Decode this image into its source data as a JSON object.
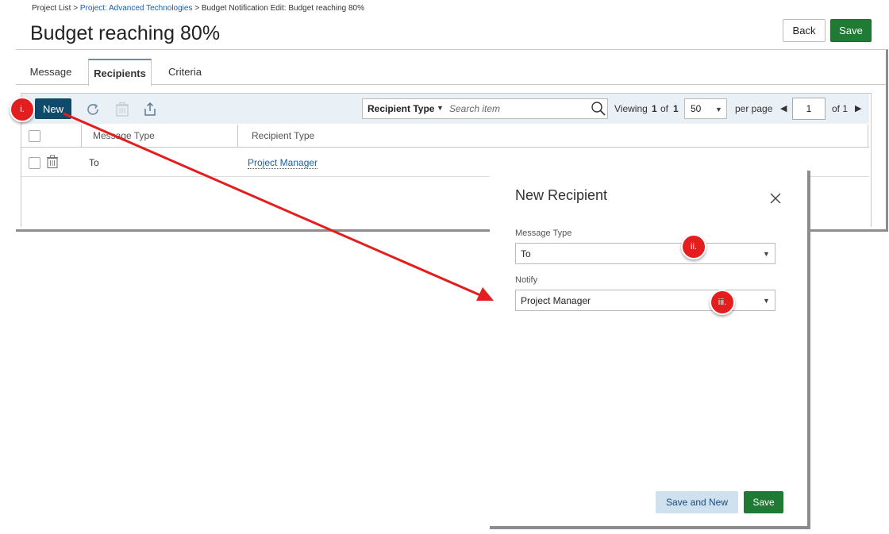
{
  "breadcrumb": {
    "item1": "Project List",
    "sep1": ">",
    "item2": "Project: Advanced Technologies",
    "sep2": ">",
    "item3": "Budget Notification Edit: Budget reaching 80%"
  },
  "header": {
    "title": "Budget reaching 80%",
    "back_label": "Back",
    "save_label": "Save"
  },
  "tabs": [
    {
      "label": "Message"
    },
    {
      "label": "Recipients"
    },
    {
      "label": "Criteria"
    }
  ],
  "active_tab": "Recipients",
  "toolbar": {
    "new_label": "New",
    "search_type_label": "Recipient Type",
    "search_placeholder": "Search item",
    "viewing_label": "Viewing",
    "viewing_from": "1",
    "viewing_of_label": "of",
    "viewing_total": "1",
    "page_size": "50",
    "per_page_label": "per page",
    "current_page": "1",
    "page_of_label": "of 1"
  },
  "table": {
    "columns": [
      "Message Type",
      "Recipient Type"
    ],
    "rows": [
      {
        "message_type": "To",
        "recipient_type": "Project Manager"
      }
    ]
  },
  "dialog": {
    "title": "New Recipient",
    "message_type_label": "Message Type",
    "message_type_value": "To",
    "notify_label": "Notify",
    "notify_value": "Project Manager",
    "save_and_new_label": "Save and New",
    "save_label": "Save"
  },
  "callouts": [
    "i.",
    "ii.",
    "iii."
  ],
  "colors": {
    "accent_green": "#1f7a33",
    "new_button": "#0f4a6b",
    "callout_red": "#e41e1e",
    "link_blue": "#1a5fa8"
  }
}
